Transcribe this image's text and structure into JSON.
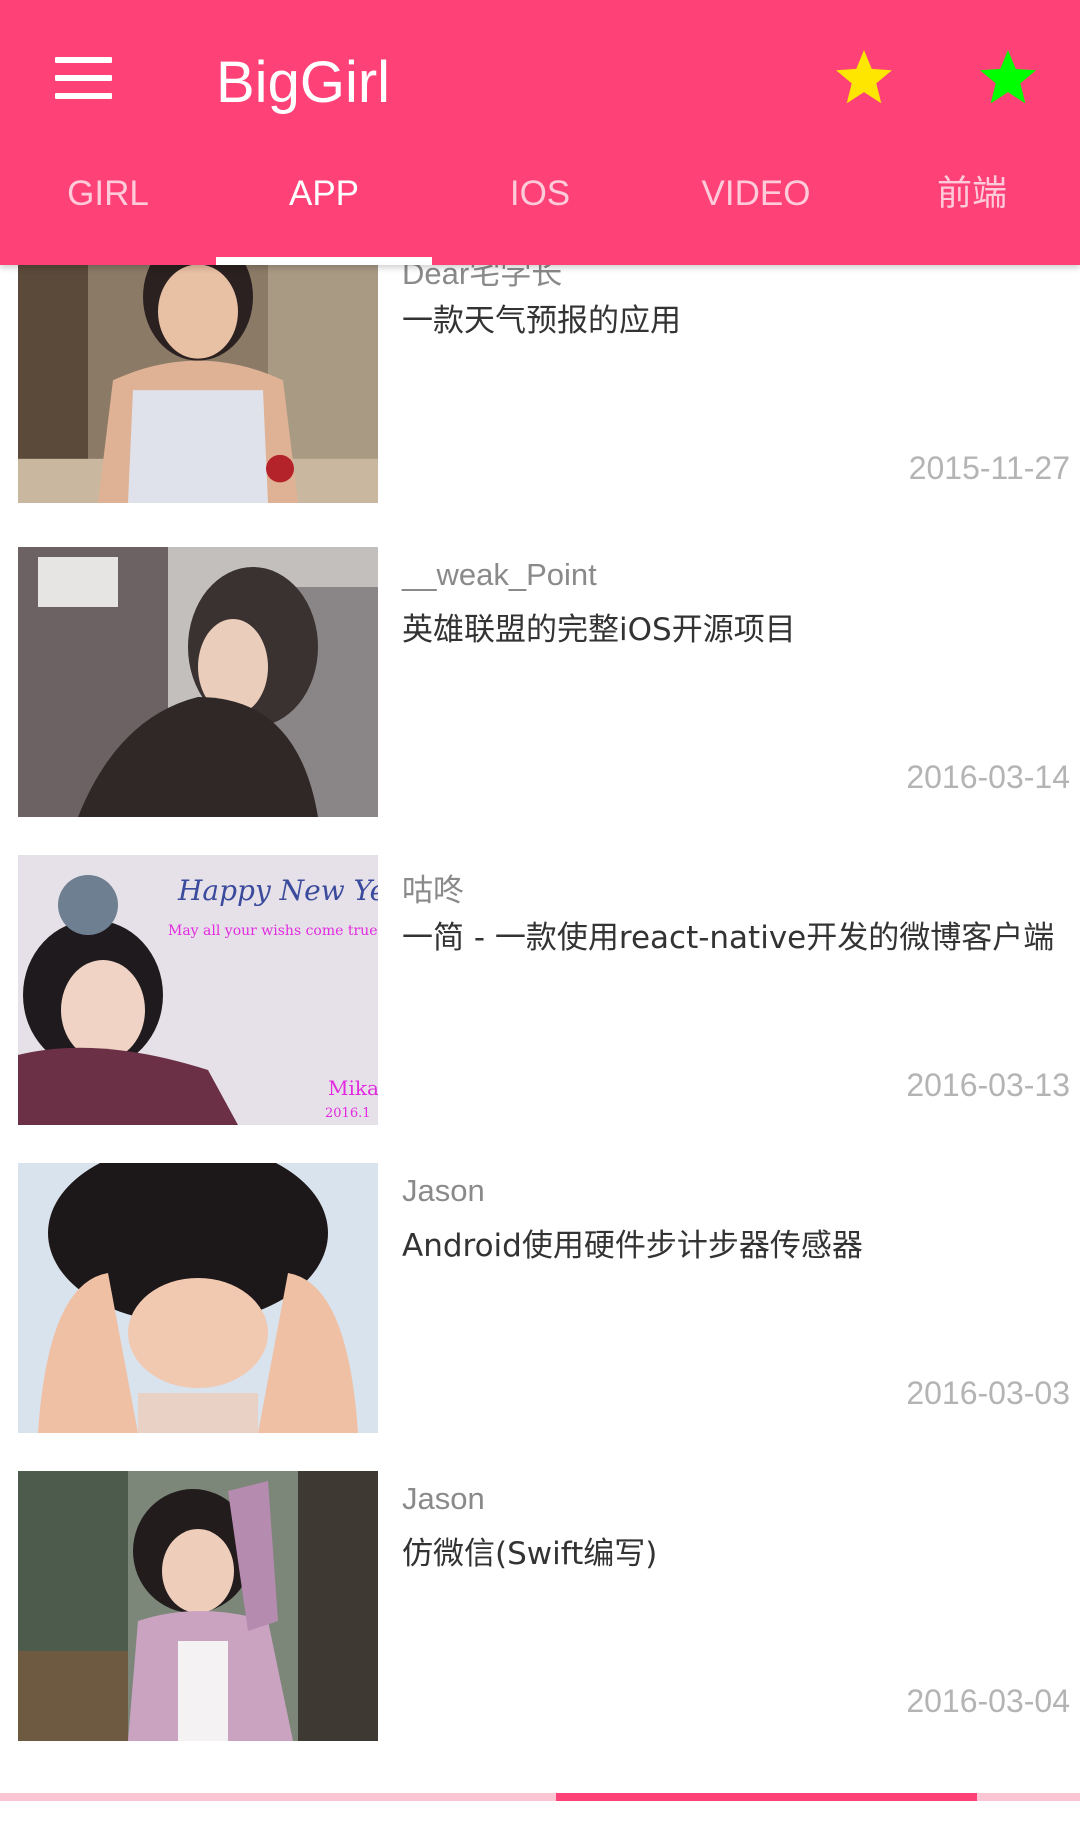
{
  "appbar": {
    "title": "BigGirl",
    "menu_icon": "hamburger-menu-icon",
    "background": "#fe4177",
    "stars": [
      {
        "icon": "star-icon",
        "color": "#ffe600"
      },
      {
        "icon": "star-icon",
        "color": "#00ff00"
      }
    ]
  },
  "tabs": [
    {
      "label": "GIRL",
      "active": false
    },
    {
      "label": "APP",
      "active": true
    },
    {
      "label": "IOS",
      "active": false
    },
    {
      "label": "VIDEO",
      "active": false
    },
    {
      "label": "前端",
      "active": false
    }
  ],
  "items": [
    {
      "author": "Dear宅学长",
      "title": "一款天气预报的应用",
      "date": "2015-11-27"
    },
    {
      "author": "__weak_Point",
      "title": "英雄联盟的完整iOS开源项目",
      "date": "2016-03-14"
    },
    {
      "author": "咕咚",
      "title": "一简 - 一款使用react-native开发的微博客户端",
      "date": "2016-03-13",
      "thumb_text": {
        "line1": "Happy New Year",
        "line2": "May all your wishs come true",
        "line3": "Mika",
        "line4": "2016.1"
      }
    },
    {
      "author": "Jason",
      "title": "Android使用硬件步计步器传感器",
      "date": "2016-03-03"
    },
    {
      "author": "Jason",
      "title": "仿微信(Swift编写)",
      "date": "2016-03-04"
    }
  ],
  "scroll_progress": {
    "start": 0.515,
    "end": 0.905
  }
}
